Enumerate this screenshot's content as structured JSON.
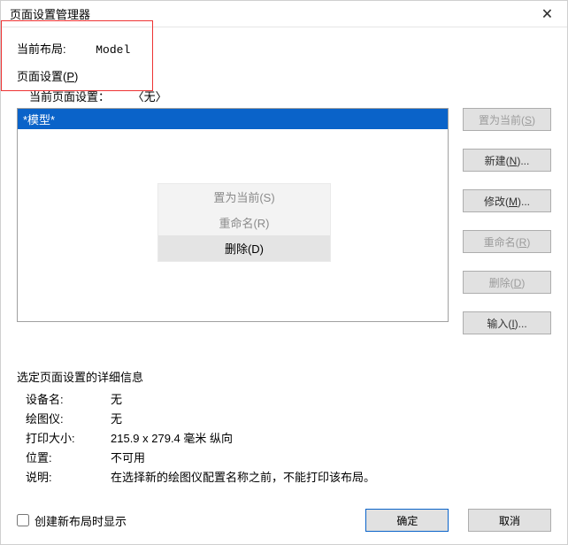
{
  "titlebar": {
    "title": "页面设置管理器"
  },
  "current_layout": {
    "label": "当前布局:",
    "value": "Model"
  },
  "page_setup": {
    "group_label": "页面设置",
    "group_accel": "P",
    "current_label": "当前页面设置：",
    "current_value": "〈无〉",
    "list_items": [
      "*模型*"
    ],
    "buttons": {
      "set_current": "置为当前",
      "set_current_accel": "S",
      "new": "新建",
      "new_accel": "N",
      "ellipsis": "...",
      "modify": "修改",
      "modify_accel": "M",
      "rename": "重命名",
      "rename_accel": "R",
      "delete": "删除",
      "delete_accel": "D",
      "import": "输入",
      "import_accel": "I"
    }
  },
  "context_menu": {
    "set_current": "置为当前(S)",
    "rename": "重命名(R)",
    "delete": "删除(D)"
  },
  "details": {
    "title": "选定页面设置的详细信息",
    "rows": {
      "device_label": "设备名:",
      "device_value": "无",
      "plotter_label": "绘图仪:",
      "plotter_value": "无",
      "size_label": "打印大小:",
      "size_value": "215.9 x 279.4 毫米  纵向",
      "location_label": "位置:",
      "location_value": "不可用",
      "desc_label": "说明:",
      "desc_value": "在选择新的绘图仪配置名称之前，不能打印该布局。"
    }
  },
  "footer": {
    "checkbox_label": "创建新布局时显示",
    "ok": "确定",
    "cancel": "取消"
  }
}
